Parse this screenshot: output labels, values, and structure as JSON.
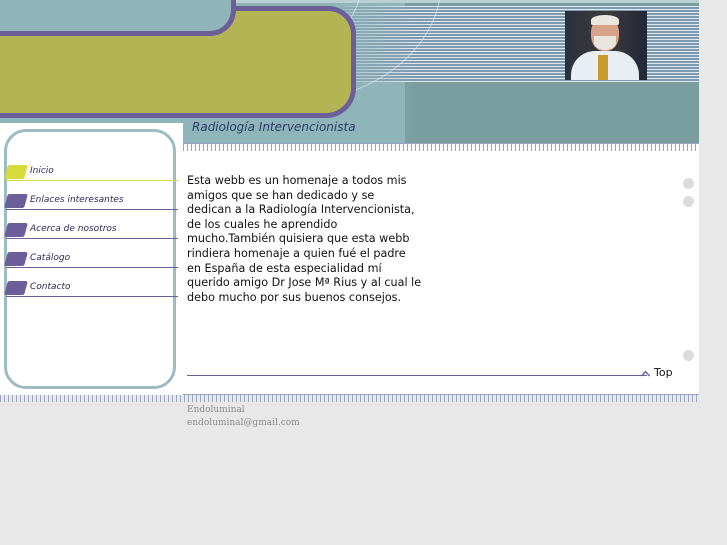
{
  "header": {
    "subtitle": "Radiología Intervencionista",
    "photo_alt": "portrait photo"
  },
  "nav": {
    "items": [
      {
        "label": "Inicio",
        "active": true
      },
      {
        "label": "Enlaces interesantes",
        "active": false
      },
      {
        "label": "Acerca de nosotros",
        "active": false
      },
      {
        "label": "Catálogo",
        "active": false
      },
      {
        "label": "Contacto",
        "active": false
      }
    ]
  },
  "main": {
    "intro_lines": [
      "Esta webb es un homenaje a todos mis",
      "amigos que se han dedicado y se",
      "dedican a la Radiología Intervencionista,",
      "de los cuales he aprendido",
      "mucho.También quisiera que esta webb",
      "rindiera homenaje a quien fué el padre",
      "en España de esta especialidad mí",
      "querido amigo Dr Jose Mª Rius y al cual le",
      "debo mucho por sus buenos consejos."
    ],
    "top_link": "Top"
  },
  "footer": {
    "name": "Endoluminal",
    "email": "endoluminal@gmail.com"
  },
  "colors": {
    "header_teal": "#8fb4b9",
    "olive": "#b3b554",
    "purple": "#6b5e99",
    "active_tab": "#d7db3c"
  }
}
